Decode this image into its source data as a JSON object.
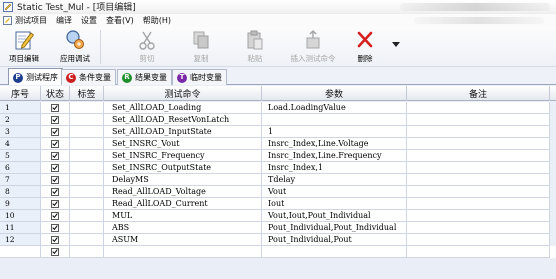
{
  "window": {
    "title": "Static Test_Mul - [项目编辑]"
  },
  "menu": {
    "items": [
      "测试项目",
      "编译",
      "设置",
      "查看(V)",
      "帮助(H)"
    ]
  },
  "toolbar": {
    "buttons": [
      {
        "label": "项目编辑",
        "icon": "edit-pencil-icon",
        "enabled": true
      },
      {
        "label": "应用调试",
        "icon": "debug-magnifier-icon",
        "enabled": true
      },
      {
        "label": "剪切",
        "icon": "scissors-icon",
        "enabled": false
      },
      {
        "label": "复制",
        "icon": "copy-icon",
        "enabled": false
      },
      {
        "label": "粘贴",
        "icon": "paste-icon",
        "enabled": false
      },
      {
        "label": "插入测试命令",
        "icon": "insert-command-icon",
        "enabled": false
      },
      {
        "label": "删除",
        "icon": "delete-x-icon",
        "enabled": true
      }
    ]
  },
  "tabs": [
    {
      "label": "测试程序",
      "badge": "P",
      "badge_color": "#1f3f8f",
      "active": true
    },
    {
      "label": "条件变量",
      "badge": "C",
      "badge_color": "#cc1f1f",
      "active": false
    },
    {
      "label": "结果变量",
      "badge": "R",
      "badge_color": "#1e8f2a",
      "active": false
    },
    {
      "label": "临时变量",
      "badge": "T",
      "badge_color": "#7a2aa8",
      "active": false
    }
  ],
  "grid": {
    "columns": [
      "序号",
      "状态",
      "标签",
      "测试命令",
      "参数",
      "备注"
    ],
    "rows": [
      {
        "num": "1",
        "checked": true,
        "tag": "",
        "command": "Set_AllLOAD_Loading",
        "params": "Load.LoadingValue",
        "note": ""
      },
      {
        "num": "2",
        "checked": true,
        "tag": "",
        "command": "Set_AllLOAD_ResetVonLatch",
        "params": "",
        "note": ""
      },
      {
        "num": "3",
        "checked": true,
        "tag": "",
        "command": "Set_AllLOAD_InputState",
        "params": "1",
        "note": ""
      },
      {
        "num": "4",
        "checked": true,
        "tag": "",
        "command": "Set_INSRC_Vout",
        "params": "Insrc_Index,Line.Voltage",
        "note": ""
      },
      {
        "num": "5",
        "checked": true,
        "tag": "",
        "command": "Set_INSRC_Frequency",
        "params": "Insrc_Index,Line.Frequency",
        "note": ""
      },
      {
        "num": "6",
        "checked": true,
        "tag": "",
        "command": "Set_INSRC_OutputState",
        "params": "Insrc_Index,1",
        "note": ""
      },
      {
        "num": "7",
        "checked": true,
        "tag": "",
        "command": "DelayMS",
        "params": "Tdelay",
        "note": ""
      },
      {
        "num": "8",
        "checked": true,
        "tag": "",
        "command": "Read_AllLOAD_Voltage",
        "params": "Vout",
        "note": ""
      },
      {
        "num": "9",
        "checked": true,
        "tag": "",
        "command": "Read_AllLOAD_Current",
        "params": "Iout",
        "note": ""
      },
      {
        "num": "10",
        "checked": true,
        "tag": "",
        "command": "MUL",
        "params": "Vout,Iout,Pout_Individual",
        "note": ""
      },
      {
        "num": "11",
        "checked": true,
        "tag": "",
        "command": "ABS",
        "params": "Pout_Individual,Pout_Individual",
        "note": ""
      },
      {
        "num": "12",
        "checked": true,
        "tag": "",
        "command": "ASUM",
        "params": "Pout_Individual,Pout",
        "note": ""
      },
      {
        "num": "",
        "checked": true,
        "tag": "",
        "command": "",
        "params": "",
        "note": ""
      }
    ]
  }
}
